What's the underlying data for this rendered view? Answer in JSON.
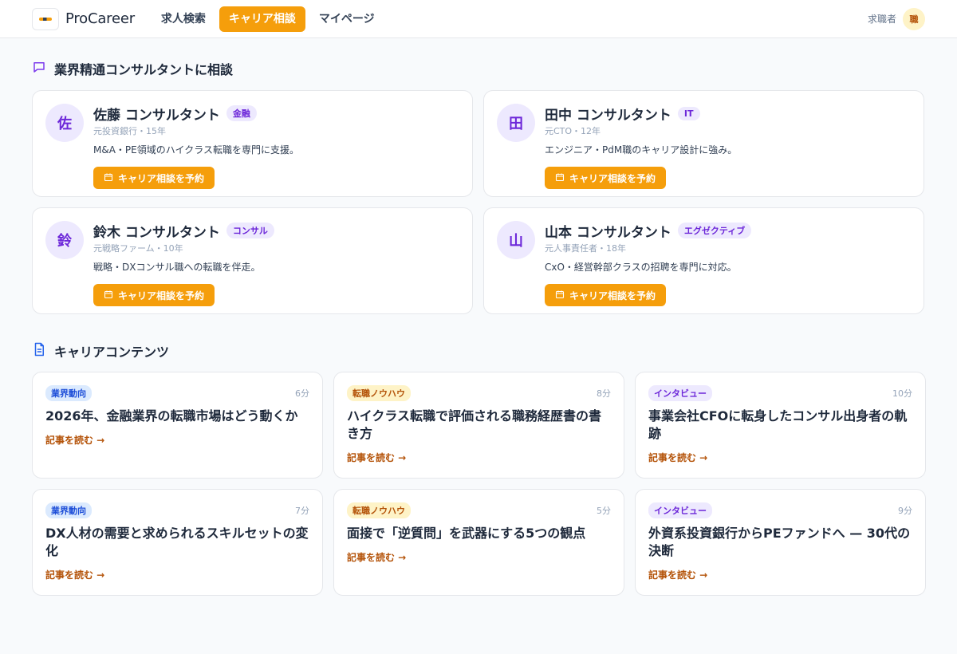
{
  "header": {
    "brand": "ProCareer",
    "nav": [
      "求人検索",
      "キャリア相談",
      "マイページ"
    ],
    "role": "求職者",
    "avatar_initial": "職"
  },
  "consult_section": {
    "title": "業界精通コンサルタントに相談",
    "button_label": "キャリア相談を予約",
    "consultants": [
      {
        "initial": "佐",
        "name": "佐藤 コンサルタント",
        "tag": "金融",
        "meta": "元投資銀行・15年",
        "desc": "M&A・PE領域のハイクラス転職を専門に支援。"
      },
      {
        "initial": "田",
        "name": "田中 コンサルタント",
        "tag": "IT",
        "meta": "元CTO・12年",
        "desc": "エンジニア・PdM職のキャリア設計に強み。"
      },
      {
        "initial": "鈴",
        "name": "鈴木 コンサルタント",
        "tag": "コンサル",
        "meta": "元戦略ファーム・10年",
        "desc": "戦略・DXコンサル職への転職を伴走。"
      },
      {
        "initial": "山",
        "name": "山本 コンサルタント",
        "tag": "エグゼクティブ",
        "meta": "元人事責任者・18年",
        "desc": "CxO・経営幹部クラスの招聘を専門に対応。"
      }
    ]
  },
  "content_section": {
    "title": "キャリアコンテンツ",
    "link_label": "記事を読む →",
    "articles": [
      {
        "tag": "業界動向",
        "time": "6分",
        "title": "2026年、金融業界の転職市場はどう動くか"
      },
      {
        "tag": "転職ノウハウ",
        "time": "8分",
        "title": "ハイクラス転職で評価される職務経歴書の書き方"
      },
      {
        "tag": "インタビュー",
        "time": "10分",
        "title": "事業会社CFOに転身したコンサル出身者の軌跡"
      },
      {
        "tag": "業界動向",
        "time": "7分",
        "title": "DX人材の需要と求められるスキルセットの変化"
      },
      {
        "tag": "転職ノウハウ",
        "time": "5分",
        "title": "面接で「逆質問」を武器にする5つの観点"
      },
      {
        "tag": "インタビュー",
        "time": "9分",
        "title": "外資系投資銀行からPEファンドへ — 30代の決断"
      }
    ]
  },
  "colors": {
    "accent": "#f59e0b",
    "purple": "#6d28d9",
    "blue": "#1d4ed8",
    "amber_text": "#b45309"
  }
}
